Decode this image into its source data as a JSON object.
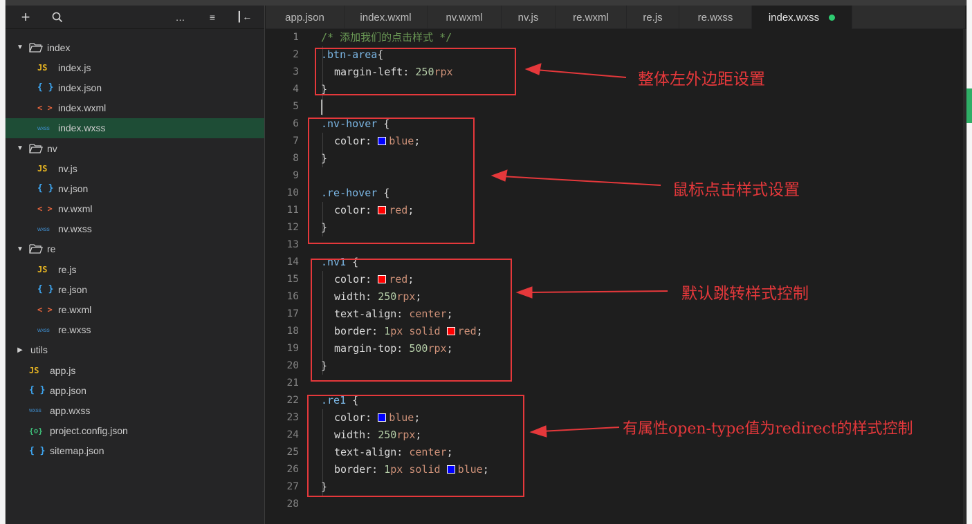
{
  "sidebar": {
    "toolbar": {
      "add_icon": "+",
      "search_icon": "search-icon",
      "more_icon": "…",
      "sort_icon": "≡",
      "split_icon": "┃←"
    },
    "tree": [
      {
        "type": "folder",
        "label": "index",
        "open": true,
        "depth": 0
      },
      {
        "type": "js",
        "label": "index.js",
        "depth": 1,
        "icon": "JS"
      },
      {
        "type": "json",
        "label": "index.json",
        "depth": 1,
        "icon": "{ }"
      },
      {
        "type": "wxml",
        "label": "index.wxml",
        "depth": 1,
        "icon": "< >"
      },
      {
        "type": "wxss",
        "label": "index.wxss",
        "depth": 1,
        "icon": "wxss",
        "selected": true
      },
      {
        "type": "folder",
        "label": "nv",
        "open": true,
        "depth": 0
      },
      {
        "type": "js",
        "label": "nv.js",
        "depth": 1,
        "icon": "JS"
      },
      {
        "type": "json",
        "label": "nv.json",
        "depth": 1,
        "icon": "{ }"
      },
      {
        "type": "wxml",
        "label": "nv.wxml",
        "depth": 1,
        "icon": "< >"
      },
      {
        "type": "wxss",
        "label": "nv.wxss",
        "depth": 1,
        "icon": "wxss"
      },
      {
        "type": "folder",
        "label": "re",
        "open": true,
        "depth": 0
      },
      {
        "type": "js",
        "label": "re.js",
        "depth": 1,
        "icon": "JS"
      },
      {
        "type": "json",
        "label": "re.json",
        "depth": 1,
        "icon": "{ }"
      },
      {
        "type": "wxml",
        "label": "re.wxml",
        "depth": 1,
        "icon": "< >"
      },
      {
        "type": "wxss",
        "label": "re.wxss",
        "depth": 1,
        "icon": "wxss"
      },
      {
        "type": "folder",
        "label": "utils",
        "open": false,
        "depth": 0
      },
      {
        "type": "js",
        "label": "app.js",
        "depth": 0,
        "icon": "JS"
      },
      {
        "type": "json",
        "label": "app.json",
        "depth": 0,
        "icon": "{ }"
      },
      {
        "type": "wxss",
        "label": "app.wxss",
        "depth": 0,
        "icon": "wxss"
      },
      {
        "type": "cfg",
        "label": "project.config.json",
        "depth": 0,
        "icon": "{⚙}"
      },
      {
        "type": "json",
        "label": "sitemap.json",
        "depth": 0,
        "icon": "{ }"
      }
    ]
  },
  "tabs": [
    {
      "label": "app.json"
    },
    {
      "label": "index.wxml"
    },
    {
      "label": "nv.wxml"
    },
    {
      "label": "nv.js"
    },
    {
      "label": "re.wxml"
    },
    {
      "label": "re.js"
    },
    {
      "label": "re.wxss"
    },
    {
      "label": "index.wxss",
      "active": true,
      "modified": true
    }
  ],
  "editor": {
    "lines": [
      {
        "n": "1",
        "tokens": [
          [
            "c-comment",
            "/* 添加我们的点击样式 */"
          ]
        ]
      },
      {
        "n": "2",
        "tokens": [
          [
            "c-sel",
            ".btn-area"
          ],
          [
            "c-prop",
            "{"
          ]
        ]
      },
      {
        "n": "3",
        "indent": true,
        "tokens": [
          [
            "c-prop",
            "margin-left: "
          ],
          [
            "c-num",
            "250"
          ],
          [
            "c-unit",
            "rpx"
          ]
        ]
      },
      {
        "n": "4",
        "tokens": [
          [
            "c-prop",
            "}"
          ]
        ]
      },
      {
        "n": "5",
        "tokens": []
      },
      {
        "n": "6",
        "tokens": [
          [
            "c-sel",
            ".nv-hover"
          ],
          [
            "c-prop",
            " {"
          ]
        ]
      },
      {
        "n": "7",
        "indent": true,
        "tokens": [
          [
            "c-prop",
            "color: "
          ],
          [
            "sw-blue",
            ""
          ],
          [
            "c-val",
            "blue"
          ],
          [
            "c-prop",
            ";"
          ]
        ]
      },
      {
        "n": "8",
        "tokens": [
          [
            "c-prop",
            "}"
          ]
        ]
      },
      {
        "n": "9",
        "tokens": []
      },
      {
        "n": "10",
        "tokens": [
          [
            "c-sel",
            ".re-hover"
          ],
          [
            "c-prop",
            " {"
          ]
        ]
      },
      {
        "n": "11",
        "indent": true,
        "tokens": [
          [
            "c-prop",
            "color: "
          ],
          [
            "sw-red",
            ""
          ],
          [
            "c-val",
            "red"
          ],
          [
            "c-prop",
            ";"
          ]
        ]
      },
      {
        "n": "12",
        "tokens": [
          [
            "c-prop",
            "}"
          ]
        ]
      },
      {
        "n": "13",
        "tokens": []
      },
      {
        "n": "14",
        "tokens": [
          [
            "c-sel",
            ".nv1"
          ],
          [
            "c-prop",
            " {"
          ]
        ]
      },
      {
        "n": "15",
        "indent": true,
        "tokens": [
          [
            "c-prop",
            "color: "
          ],
          [
            "sw-red",
            ""
          ],
          [
            "c-val",
            "red"
          ],
          [
            "c-prop",
            ";"
          ]
        ]
      },
      {
        "n": "16",
        "indent": true,
        "tokens": [
          [
            "c-prop",
            "width: "
          ],
          [
            "c-num",
            "250"
          ],
          [
            "c-unit",
            "rpx"
          ],
          [
            "c-prop",
            ";"
          ]
        ]
      },
      {
        "n": "17",
        "indent": true,
        "tokens": [
          [
            "c-prop",
            "text-align: "
          ],
          [
            "c-val",
            "center"
          ],
          [
            "c-prop",
            ";"
          ]
        ]
      },
      {
        "n": "18",
        "indent": true,
        "tokens": [
          [
            "c-prop",
            "border: "
          ],
          [
            "c-num",
            "1"
          ],
          [
            "c-unit",
            "px"
          ],
          [
            "c-val",
            " solid "
          ],
          [
            "sw-red",
            ""
          ],
          [
            "c-val",
            "red"
          ],
          [
            "c-prop",
            ";"
          ]
        ]
      },
      {
        "n": "19",
        "indent": true,
        "tokens": [
          [
            "c-prop",
            "margin-top: "
          ],
          [
            "c-num",
            "500"
          ],
          [
            "c-unit",
            "rpx"
          ],
          [
            "c-prop",
            ";"
          ]
        ]
      },
      {
        "n": "20",
        "tokens": [
          [
            "c-prop",
            "}"
          ]
        ]
      },
      {
        "n": "21",
        "tokens": []
      },
      {
        "n": "22",
        "tokens": [
          [
            "c-sel",
            ".re1"
          ],
          [
            "c-prop",
            " {"
          ]
        ]
      },
      {
        "n": "23",
        "indent": true,
        "tokens": [
          [
            "c-prop",
            "color: "
          ],
          [
            "sw-blue",
            ""
          ],
          [
            "c-val",
            "blue"
          ],
          [
            "c-prop",
            ";"
          ]
        ]
      },
      {
        "n": "24",
        "indent": true,
        "tokens": [
          [
            "c-prop",
            "width: "
          ],
          [
            "c-num",
            "250"
          ],
          [
            "c-unit",
            "rpx"
          ],
          [
            "c-prop",
            ";"
          ]
        ]
      },
      {
        "n": "25",
        "indent": true,
        "tokens": [
          [
            "c-prop",
            "text-align: "
          ],
          [
            "c-val",
            "center"
          ],
          [
            "c-prop",
            ";"
          ]
        ]
      },
      {
        "n": "26",
        "indent": true,
        "tokens": [
          [
            "c-prop",
            "border: "
          ],
          [
            "c-num",
            "1"
          ],
          [
            "c-unit",
            "px"
          ],
          [
            "c-val",
            " solid "
          ],
          [
            "sw-blue",
            ""
          ],
          [
            "c-val",
            "blue"
          ],
          [
            "c-prop",
            ";"
          ]
        ]
      },
      {
        "n": "27",
        "tokens": [
          [
            "c-prop",
            "}"
          ]
        ]
      },
      {
        "n": "28",
        "tokens": []
      }
    ]
  },
  "annotations": {
    "note1": "整体左外边距设置",
    "note2": "鼠标点击样式设置",
    "note3": "默认跳转样式控制",
    "note4": "有属性open-type值为redirect的样式控制"
  },
  "colors": {
    "annotation": "#e5383b",
    "selected_row": "#1e4d36",
    "modified_dot": "#2ecc71"
  }
}
